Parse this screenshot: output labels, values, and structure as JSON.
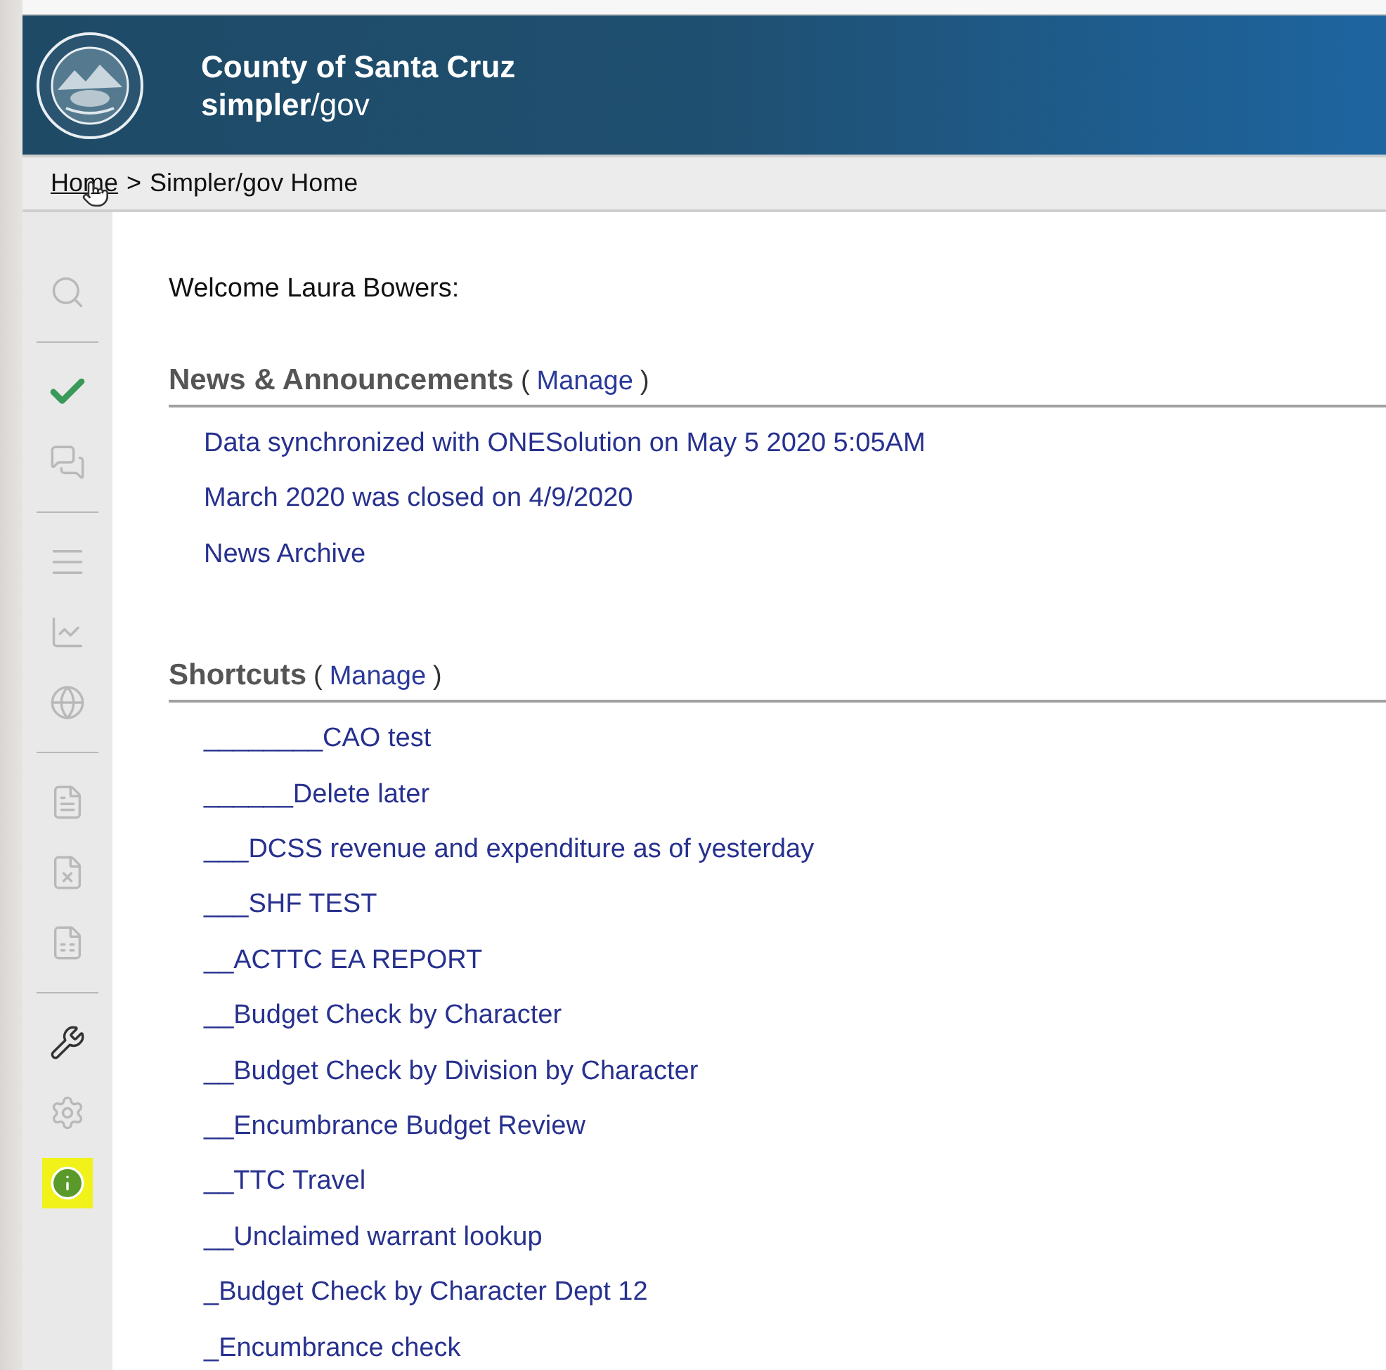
{
  "header": {
    "title": "County of Santa Cruz",
    "subtitle_bold": "simpler",
    "subtitle_rest": "/gov"
  },
  "breadcrumb": {
    "link": "Home",
    "separator": ">",
    "current": "Simpler/gov Home"
  },
  "sidebar": {
    "items": [
      {
        "kind": "icon",
        "disabled": true,
        "selected": false
      },
      {
        "kind": "divider"
      },
      {
        "kind": "icon",
        "disabled": false,
        "selected": false
      },
      {
        "kind": "icon",
        "disabled": true,
        "selected": false
      },
      {
        "kind": "divider"
      },
      {
        "kind": "icon",
        "disabled": true,
        "selected": false
      },
      {
        "kind": "icon",
        "disabled": true,
        "selected": false
      },
      {
        "kind": "icon",
        "disabled": true,
        "selected": false
      },
      {
        "kind": "divider"
      },
      {
        "kind": "icon",
        "disabled": true,
        "selected": false
      },
      {
        "kind": "icon",
        "disabled": true,
        "selected": false
      },
      {
        "kind": "icon",
        "disabled": true,
        "selected": false
      },
      {
        "kind": "divider"
      },
      {
        "kind": "icon",
        "disabled": false,
        "selected": false
      },
      {
        "kind": "icon",
        "disabled": true,
        "selected": false
      },
      {
        "kind": "icon",
        "disabled": false,
        "selected": true
      }
    ]
  },
  "welcome": "Welcome Laura Bowers:",
  "sections": [
    {
      "title": "News & Announcements",
      "open": "(",
      "manage": "Manage",
      "close": ")",
      "links": [
        "Data synchronized with ONESolution on May 5 2020 5:05AM",
        "March 2020 was closed on 4/9/2020",
        "News Archive"
      ]
    },
    {
      "title": "Shortcuts",
      "open": "(",
      "manage": "Manage",
      "close": ")",
      "links": [
        "________CAO test",
        "______Delete later",
        "___DCSS revenue and expenditure as of yesterday",
        "___SHF TEST",
        "__ACTTC EA REPORT",
        "__Budget Check by Character",
        "__Budget Check by Division by Character",
        "__Encumbrance Budget Review",
        "__TTC Travel",
        "__Unclaimed warrant lookup",
        "_Budget Check by Character Dept 12",
        "_Encumbrance check"
      ]
    }
  ]
}
